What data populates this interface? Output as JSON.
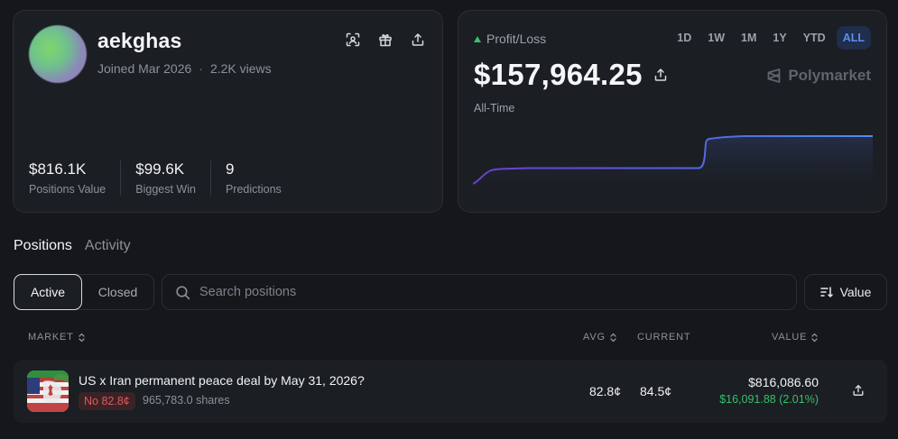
{
  "profile": {
    "username": "aekghas",
    "joined": "Joined Mar 2026",
    "views": "2.2K views",
    "icons": [
      "scan-icon",
      "gift-icon",
      "share-icon"
    ],
    "stats": [
      {
        "value": "$816.1K",
        "label": "Positions Value"
      },
      {
        "value": "$99.6K",
        "label": "Biggest Win"
      },
      {
        "value": "9",
        "label": "Predictions"
      }
    ]
  },
  "pl": {
    "label": "Profit/Loss",
    "amount": "$157,964.25",
    "period": "All-Time",
    "brand": "Polymarket",
    "ranges": [
      "1D",
      "1W",
      "1M",
      "1Y",
      "YTD",
      "ALL"
    ],
    "active_range": "ALL",
    "accent_color": "#5b8ff0",
    "up_color": "#34c26a"
  },
  "tabs": [
    "Positions",
    "Activity"
  ],
  "filters": {
    "active_label": "Active",
    "closed_label": "Closed",
    "search_placeholder": "Search positions",
    "sort_label": "Value"
  },
  "table": {
    "headers": {
      "market": "MARKET",
      "avg": "AVG",
      "current": "CURRENT",
      "value": "VALUE"
    },
    "rows": [
      {
        "title": "US x Iran permanent peace deal by May 31, 2026?",
        "outcome": "No 82.8¢",
        "shares": "965,783.0 shares",
        "avg": "82.8¢",
        "current": "84.5¢",
        "value": "$816,086.60",
        "pnl": "$16,091.88 (2.01%)"
      }
    ]
  }
}
